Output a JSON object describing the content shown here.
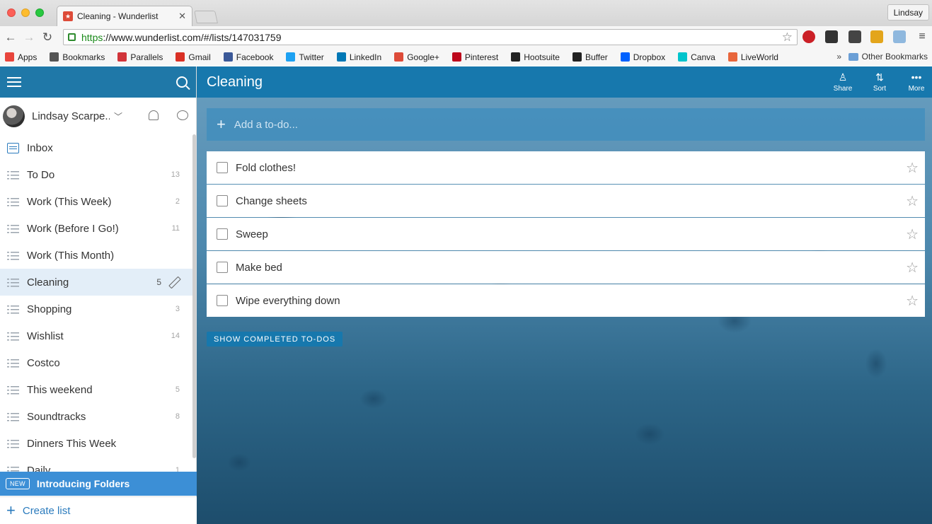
{
  "browser": {
    "tab_title": "Cleaning - Wunderlist",
    "profile_name": "Lindsay",
    "url_scheme": "https",
    "url_rest": "://www.wunderlist.com/#/lists/147031759",
    "bookmarks": [
      {
        "label": "Apps",
        "icon": "apps-grid-icon",
        "color": "#e8453c"
      },
      {
        "label": "Bookmarks",
        "icon": "star-icon",
        "color": "#555555"
      },
      {
        "label": "Parallels",
        "icon": "parallels-icon",
        "color": "#d1343a"
      },
      {
        "label": "Gmail",
        "icon": "gmail-icon",
        "color": "#d93025"
      },
      {
        "label": "Facebook",
        "icon": "facebook-icon",
        "color": "#3b5998"
      },
      {
        "label": "Twitter",
        "icon": "twitter-icon",
        "color": "#1da1f2"
      },
      {
        "label": "LinkedIn",
        "icon": "linkedin-icon",
        "color": "#0077b5"
      },
      {
        "label": "Google+",
        "icon": "googleplus-icon",
        "color": "#dd4b39"
      },
      {
        "label": "Pinterest",
        "icon": "pinterest-icon",
        "color": "#bd081c"
      },
      {
        "label": "Hootsuite",
        "icon": "hootsuite-icon",
        "color": "#222222"
      },
      {
        "label": "Buffer",
        "icon": "buffer-icon",
        "color": "#222222"
      },
      {
        "label": "Dropbox",
        "icon": "dropbox-icon",
        "color": "#0061fe"
      },
      {
        "label": "Canva",
        "icon": "canva-icon",
        "color": "#00c4cc"
      },
      {
        "label": "LiveWorld",
        "icon": "liveworld-icon",
        "color": "#e8663c"
      }
    ],
    "overflow": "»",
    "other_bookmarks": "Other Bookmarks"
  },
  "sidebar": {
    "user_name": "Lindsay Scarpe...",
    "lists": [
      {
        "label": "Inbox",
        "count": "",
        "icon": "inbox-icon"
      },
      {
        "label": "To Do",
        "count": "13",
        "icon": "list-icon"
      },
      {
        "label": "Work (This Week)",
        "count": "2",
        "icon": "list-icon"
      },
      {
        "label": "Work (Before I Go!)",
        "count": "11",
        "icon": "list-icon"
      },
      {
        "label": "Work (This Month)",
        "count": "",
        "icon": "list-icon"
      },
      {
        "label": "Cleaning",
        "count": "5",
        "icon": "list-icon",
        "selected": true
      },
      {
        "label": "Shopping",
        "count": "3",
        "icon": "list-icon"
      },
      {
        "label": "Wishlist",
        "count": "14",
        "icon": "list-icon"
      },
      {
        "label": "Costco",
        "count": "",
        "icon": "list-icon"
      },
      {
        "label": "This weekend",
        "count": "5",
        "icon": "list-icon"
      },
      {
        "label": "Soundtracks",
        "count": "8",
        "icon": "list-icon"
      },
      {
        "label": "Dinners This Week",
        "count": "",
        "icon": "list-icon"
      },
      {
        "label": "Daily",
        "count": "1",
        "icon": "list-icon"
      }
    ],
    "new_badge": "NEW",
    "folders_banner": "Introducing Folders",
    "create_list": "Create list"
  },
  "main": {
    "title": "Cleaning",
    "actions": [
      {
        "label": "Share",
        "icon": "share-person-icon"
      },
      {
        "label": "Sort",
        "icon": "sort-az-icon"
      },
      {
        "label": "More",
        "icon": "more-dots-icon"
      }
    ],
    "add_placeholder": "Add a to-do...",
    "tasks": [
      {
        "label": "Fold clothes!"
      },
      {
        "label": "Change sheets"
      },
      {
        "label": "Sweep"
      },
      {
        "label": "Make bed"
      },
      {
        "label": "Wipe everything down"
      }
    ],
    "show_completed": "SHOW COMPLETED TO-DOS"
  },
  "colors": {
    "header_blue": "#1778ad",
    "sidebar_top": "#1f78a8",
    "banner_blue": "#3c8fd6",
    "link_blue": "#2b7bbd",
    "selected_row": "#e3eef8"
  }
}
